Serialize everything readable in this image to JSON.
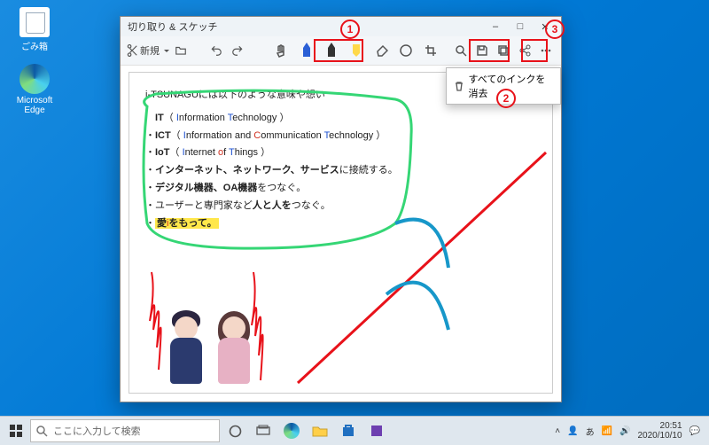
{
  "desktop": {
    "icons": [
      {
        "name": "recycle-bin",
        "label": "ごみ箱"
      },
      {
        "name": "edge",
        "label": "Microsoft Edge"
      }
    ]
  },
  "window": {
    "title": "切り取り & スケッチ",
    "btn_minimize": "–",
    "btn_maximize": "□",
    "btn_close": "✕"
  },
  "toolbar": {
    "new_label": "新規",
    "tools": {
      "undo": "undo",
      "redo": "redo",
      "pen_blue": "pen-blue",
      "pen_red": "pen-red",
      "pen_black": "pen-black",
      "highlighter": "highlighter",
      "eraser": "eraser",
      "ruler": "ruler",
      "crop": "crop",
      "zoom": "zoom",
      "save": "save",
      "copy": "copy",
      "share": "share",
      "more": "more"
    }
  },
  "popup": {
    "label": "すべてのインクを消去"
  },
  "callouts": {
    "c1": "1",
    "c2": "2",
    "c3": "3"
  },
  "document": {
    "heading": "i-TSUNAGUには以下のような意味や想い",
    "lines": [
      {
        "bullet": "",
        "pre": "IT",
        "paren_open": "（ ",
        "i1": "I",
        "t1": "nformation ",
        "i2": "T",
        "t2": "echnology ）"
      },
      {
        "bullet": "・",
        "pre": "ICT",
        "paren_open": "（ ",
        "i1": "I",
        "t1": "nformation and ",
        "i2": "C",
        "t2": "ommunication ",
        "i3": "T",
        "t3": "echnology ）"
      },
      {
        "bullet": "・",
        "pre": "IoT",
        "paren_open": "（ ",
        "i1": "I",
        "t1": "nternet ",
        "i2": "o",
        "t2": "f ",
        "i3": "T",
        "t3": "hings ）"
      },
      {
        "bullet": "・",
        "bold": "インターネット、ネットワーク、サービス",
        "rest": "に接続する。"
      },
      {
        "bullet": "・",
        "bold": "デジタル機器、OA機器",
        "rest": "をつなぐ。"
      },
      {
        "bullet": "・",
        "plain": "ユーザーと専門家など",
        "bold": "人と人を",
        "rest": "つなぐ。"
      },
      {
        "bullet": "・",
        "mark_pre": "愛",
        "mark_i": "i",
        "mark_post": "をもって。"
      }
    ]
  },
  "taskbar": {
    "search_placeholder": "ここに入力して検索",
    "time": "20:51",
    "date": "2020/10/10"
  }
}
